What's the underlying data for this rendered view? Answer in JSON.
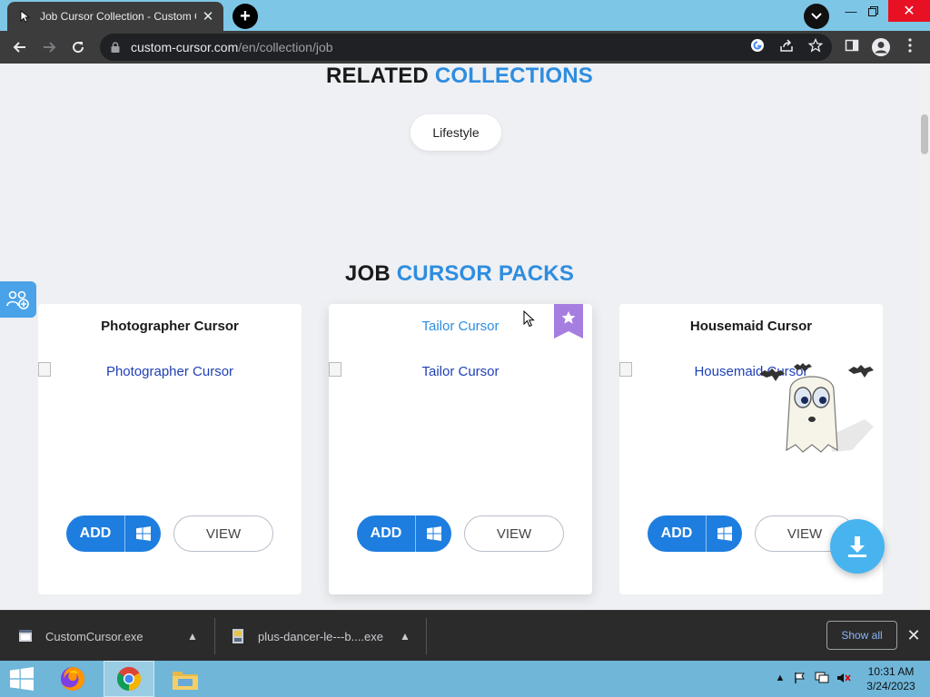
{
  "browser": {
    "tab_title": "Job Cursor Collection - Custom C",
    "url_host": "custom-cursor.com",
    "url_path": "/en/collection/job",
    "new_tab_label": "+"
  },
  "related": {
    "title_dark": "RELATED",
    "title_blue": "COLLECTIONS",
    "tags": [
      "Lifestyle"
    ]
  },
  "packs": {
    "title_dark": "JOB",
    "title_blue": "CURSOR PACKS",
    "cards": [
      {
        "name": "Photographer Cursor",
        "image_alt": "Photographer Cursor",
        "add_label": "ADD",
        "view_label": "VIEW",
        "featured": false
      },
      {
        "name": "Tailor Cursor",
        "image_alt": "Tailor Cursor",
        "add_label": "ADD",
        "view_label": "VIEW",
        "featured": true
      },
      {
        "name": "Housemaid Cursor",
        "image_alt": "Housemaid Cursor",
        "add_label": "ADD",
        "view_label": "VIEW",
        "featured": false
      }
    ]
  },
  "downloads": {
    "items": [
      "CustomCursor.exe",
      "plus-dancer-le---b....exe"
    ],
    "show_all_label": "Show all"
  },
  "taskbar": {
    "time": "10:31 AM",
    "date": "3/24/2023"
  },
  "colors": {
    "accent_blue": "#2e8de0",
    "add_button": "#1e7ee0",
    "ribbon_purple": "#a67ee0",
    "page_bg": "#eef0f3"
  },
  "icons": [
    "chrome-icon",
    "firefox-icon",
    "file-explorer-icon",
    "windows-start-icon",
    "download-icon",
    "windows-logo-icon",
    "star-ribbon-icon",
    "lock-icon",
    "google-icon",
    "share-icon",
    "bookmark-star-icon",
    "side-panel-icon",
    "profile-icon",
    "menu-dots-icon"
  ]
}
